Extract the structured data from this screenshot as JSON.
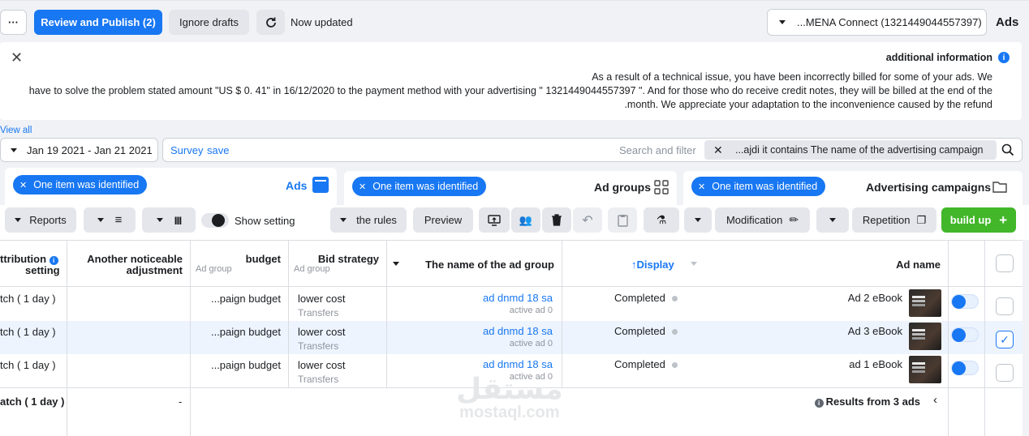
{
  "topbar": {
    "more_label": "···",
    "review_publish": "Review and Publish (2)",
    "ignore_drafts": "Ignore drafts",
    "status": "Now updated",
    "account": "...MENA Connect (1321449044557397)",
    "ads_label": "Ads"
  },
  "notice": {
    "title": "additional information",
    "line1": "As a result of a technical issue, you have been incorrectly billed for some of your ads. We",
    "line2": "have to solve the problem stated amount \"US $ 0. 41\" in 16/12/2020 to the payment method with your advertising \" 1321449044557397 \". And for those who do receive credit notes, they will be billed at the end of the",
    "line3": ".month. We appreciate your adaptation to the inconvenience caused by the refund",
    "view_all": "View all"
  },
  "filter": {
    "date_range": "Jan 19 2021 - Jan 21 2021",
    "survey": "Survey",
    "save": "save",
    "search_placeholder": "Search and filter",
    "chip": "...ajdi it contains The name of the advertising campaign"
  },
  "tabs": [
    {
      "title": "Ads",
      "pill": "One item was identified"
    },
    {
      "title": "Ad groups",
      "pill": "One item was identified"
    },
    {
      "title": "Advertising campaigns",
      "pill": "One item was identified"
    }
  ],
  "toolbar": {
    "reports": "Reports",
    "show_setting": "Show setting",
    "rules": "the rules",
    "preview": "Preview",
    "modification": "Modification",
    "repetition": "Repetition",
    "build_up": "build up",
    "plus": "+"
  },
  "table": {
    "headers": {
      "attribution": "ttribution",
      "attribution2": "setting",
      "adjustment1": "Another noticeable",
      "adjustment2": "adjustment",
      "budget": "budget",
      "budget_sub": "Ad group",
      "bid": "Bid strategy",
      "bid_sub": "Ad group",
      "adgroup_name": "The name of the ad group",
      "display": "Display",
      "ad_name": "Ad name"
    },
    "rows": [
      {
        "attribution": "tch ( 1 day )",
        "budget": "...paign budget",
        "bid": "lower cost",
        "bid_sub": "Transfers",
        "adgroup": "ad dnmd 18 sa",
        "adgroup_sub": "active ad 0",
        "display": "Completed",
        "ad_name": "Ad 2 eBook"
      },
      {
        "attribution": "tch ( 1 day )",
        "budget": "...paign budget",
        "bid": "lower cost",
        "bid_sub": "Transfers",
        "adgroup": "ad dnmd 18 sa",
        "adgroup_sub": "active ad 0",
        "display": "Completed",
        "ad_name": "Ad 3 eBook"
      },
      {
        "attribution": "tch ( 1 day )",
        "budget": "...paign budget",
        "bid": "lower cost",
        "bid_sub": "Transfers",
        "adgroup": "ad dnmd 18 sa",
        "adgroup_sub": "active ad 0",
        "display": "Completed",
        "ad_name": "ad 1 eBook"
      }
    ],
    "footer": {
      "attribution": "atch ( 1 day )",
      "adjustment": "-",
      "results": "Results from 3 ads"
    }
  },
  "watermark": {
    "arabic": "مستقل",
    "latin": "mostaql.com"
  },
  "colors": {
    "primary": "#1877f2",
    "green": "#42b72a",
    "selected_row": "#edf4fe"
  }
}
